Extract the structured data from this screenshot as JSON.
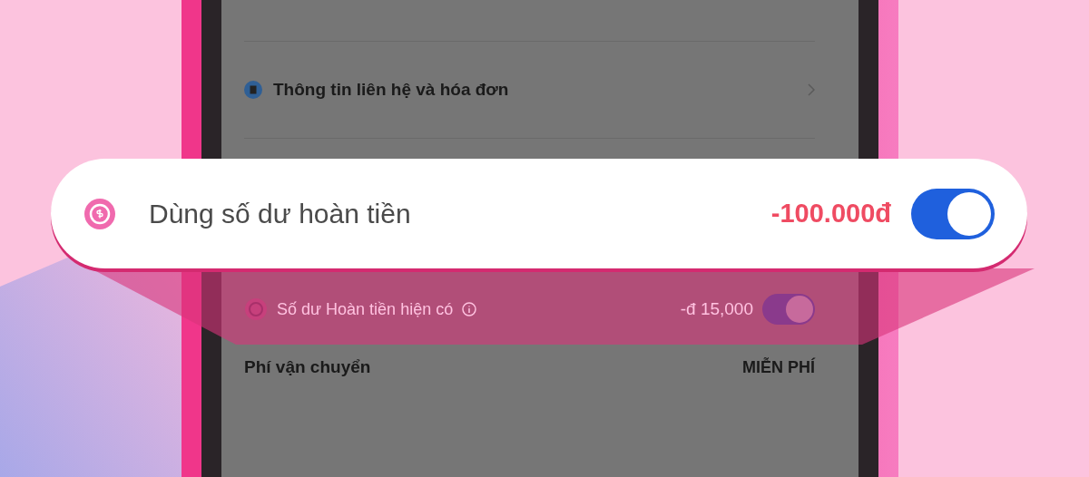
{
  "callout": {
    "label": "Dùng số dư hoàn tiền",
    "amount": "-100.000đ",
    "toggle_on": true
  },
  "screen": {
    "rows": [
      {
        "kind": "link",
        "label": "Thông tin liên hệ và hóa đơn"
      },
      {
        "kind": "balance",
        "label": "Số dư Hoàn tiền hiện có",
        "value": "-đ 15,000",
        "on": true
      },
      {
        "kind": "fee",
        "label": "Phí vận chuyển",
        "value": "MIỄN PHÍ"
      }
    ]
  }
}
